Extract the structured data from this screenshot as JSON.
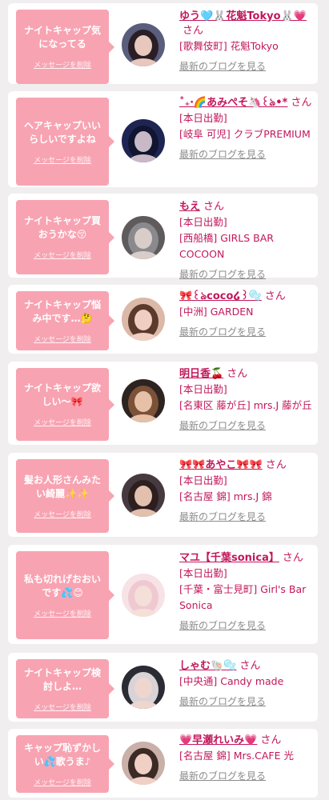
{
  "labels": {
    "delete": "メッセージを削除",
    "blog": "最新のブログを見る"
  },
  "colors": {
    "page_bg": "#f1eef0",
    "bubble": "#f8a3b2",
    "accent": "#c2185b",
    "muted": "#8c8c8c"
  },
  "items": [
    {
      "message": "ナイトキャップ気になってる",
      "name": "ゆう🩵🐰花魁Tokyo🐰💗",
      "honorific": "さん",
      "lines": [
        "[歌舞伎町] 花魁Tokyo"
      ],
      "avatar": {
        "hair": "#2a1e26",
        "skin": "#e8c7bd",
        "bg": "#5a5d7c"
      }
    },
    {
      "message": "ヘアキャップいいらしいですよね",
      "name": "˚₊‧🌈あみぺそ🦄꒰ঌ•*",
      "honorific": "さん",
      "lines": [
        "[本日出勤]",
        "[岐阜 可児] クラブPREMIUM"
      ],
      "avatar": {
        "hair": "#101530",
        "skin": "#c9b9c7",
        "bg": "#1e2552"
      }
    },
    {
      "message": "ナイトキャップ買おうかな😚",
      "name": "もえ",
      "honorific": "さん",
      "lines": [
        "[本日出勤]",
        "[西船橋] GIRLS BAR COCOON"
      ],
      "avatar": {
        "hair": "#8a8a8e",
        "skin": "#d9cdc9",
        "bg": "#5f5b5c"
      }
    },
    {
      "message": "ナイトキャップ悩み中です…🤔",
      "name": "🎀꒰ঌcoco໒꒱🫧",
      "honorific": "さん",
      "lines": [
        "[中洲] GARDEN"
      ],
      "avatar": {
        "hair": "#5a3a2c",
        "skin": "#f0cfc2",
        "bg": "#dcb8a8"
      }
    },
    {
      "message": "ナイトキャップ欲しい〜🎀",
      "name": "明日香🍒",
      "honorific": "さん",
      "lines": [
        "[本日出勤]",
        "[名東区 藤が丘] mrs.J 藤が丘"
      ],
      "avatar": {
        "hair": "#7b5138",
        "skin": "#e6c1a8",
        "bg": "#2d2320"
      }
    },
    {
      "message": "髪お人形さんみたい綺麗✨✨",
      "name": "🎀🎀あやこ🎀🎀",
      "honorific": "さん",
      "lines": [
        "[本日出勤]",
        "[名古屋 錦] mrs.J 錦"
      ],
      "avatar": {
        "hair": "#2c1f1e",
        "skin": "#e3bfae",
        "bg": "#463a40"
      }
    },
    {
      "message": "私も切れげおおいです💦😊",
      "name": "マユ【千葉sonica】",
      "honorific": "さん",
      "lines": [
        "[本日出勤]",
        "[千葉・富士見町] Girl's Bar Sonica"
      ],
      "avatar": {
        "hair": "#efc9d1",
        "skin": "#f5dfd9",
        "bg": "#f7e2e6"
      }
    },
    {
      "message": "ナイトキャップ検討しよ…",
      "name": "しゃむ🐚🫧",
      "honorific": "さん",
      "lines": [
        "[中央通] Candy made"
      ],
      "avatar": {
        "hair": "#d7d3d6",
        "skin": "#eed6cf",
        "bg": "#2b2b33"
      }
    },
    {
      "message": "キャップ恥ずかしい💦歌うま♪",
      "name": "💗早瀬れいみ💗",
      "honorific": "さん",
      "lines": [
        "[名古屋 錦] Mrs.CAFE 光"
      ],
      "avatar": {
        "hair": "#3b2a26",
        "skin": "#f0d0c4",
        "bg": "#c9b0a8"
      }
    }
  ]
}
